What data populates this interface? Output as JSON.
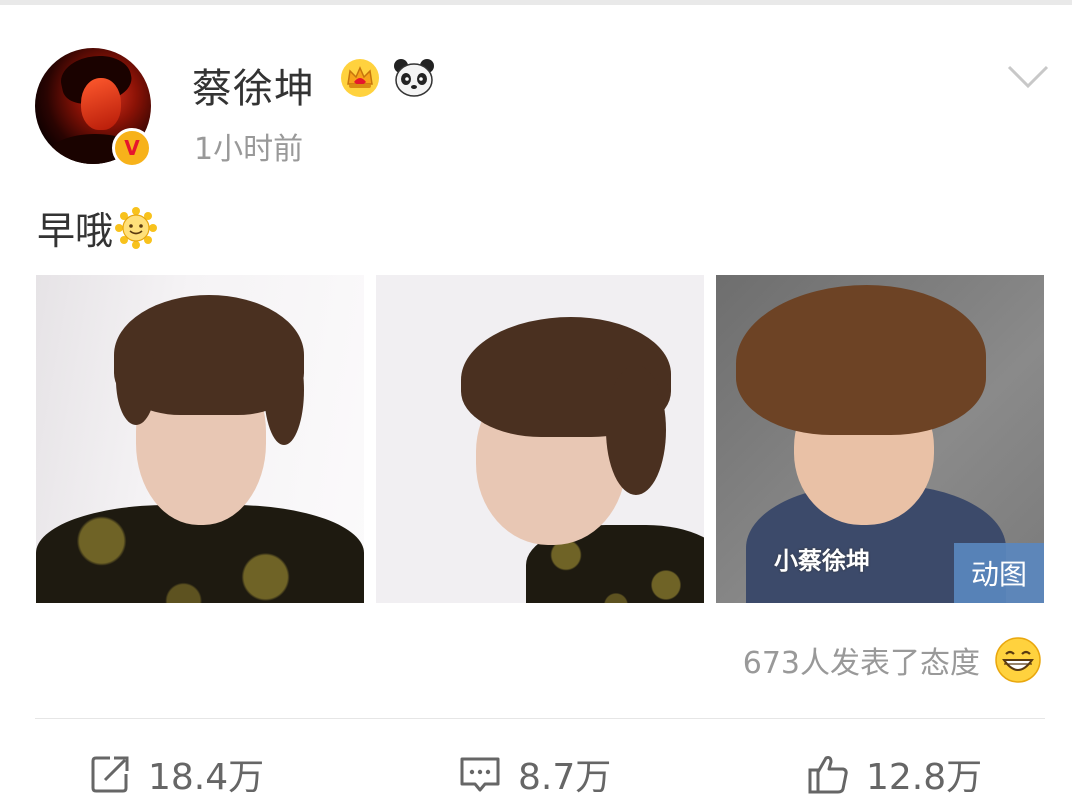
{
  "post": {
    "author": "蔡徐坤",
    "time": "1小时前",
    "text": "早哦",
    "verified_badge": "V",
    "icons": [
      "crown-icon",
      "panda-icon",
      "sun-emoji-icon",
      "chevron-down-icon"
    ],
    "images": [
      {
        "kind": "photo"
      },
      {
        "kind": "photo"
      },
      {
        "kind": "gif",
        "caption": "小蔡徐坤",
        "badge": "动图"
      }
    ],
    "reactions": {
      "text": "673人发表了态度",
      "icon": "grin-emoji-icon"
    }
  },
  "actions": {
    "repost": "18.4万",
    "comment": "8.7万",
    "like": "12.8万"
  },
  "colors": {
    "text": "#333333",
    "muted": "#999999",
    "badge": "#f7b21a",
    "gif_badge": "#5a87be"
  }
}
